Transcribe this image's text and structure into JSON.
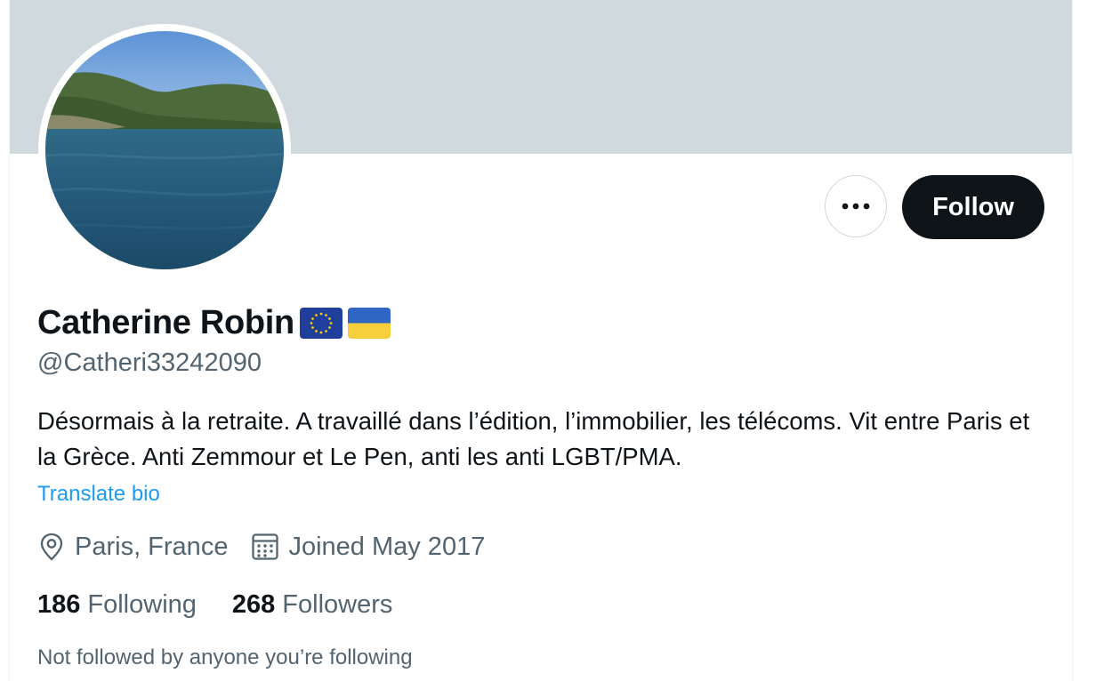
{
  "profile": {
    "display_name": "Catherine Robin",
    "flags": [
      "eu-flag-icon",
      "ukraine-flag-icon"
    ],
    "handle": "@Catheri33242090",
    "bio": "Désormais à la retraite. A travaillé dans l’édition, l’immobilier, les télécoms. Vit entre Paris et la Grèce. Anti Zemmour et Le Pen, anti les anti LGBT/PMA.",
    "translate_label": "Translate bio",
    "location": "Paris, France",
    "joined": "Joined May 2017",
    "following_count": "186",
    "following_label": "Following",
    "followers_count": "268",
    "followers_label": "Followers",
    "not_followed_note": "Not followed by anyone you’re following"
  },
  "actions": {
    "more_icon": "ellipsis-icon",
    "follow_label": "Follow"
  },
  "colors": {
    "banner": "#cfd9de",
    "primary_text": "#0f1419",
    "secondary_text": "#536471",
    "link": "#1d9bf0",
    "follow_button_bg": "#0f1419"
  }
}
